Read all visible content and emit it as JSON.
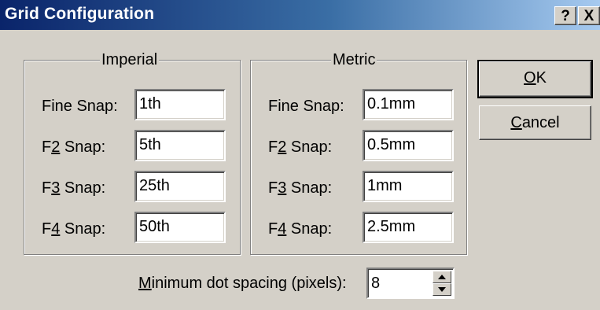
{
  "window": {
    "title": "Grid Configuration",
    "help_label": "?",
    "close_label": "X"
  },
  "imperial": {
    "title": "Imperial",
    "rows": [
      {
        "label_pre": "Fine Snap:",
        "label_u": "",
        "label_post": "",
        "value": "1th"
      },
      {
        "label_pre": "F",
        "label_u": "2",
        "label_post": " Snap:",
        "value": "5th"
      },
      {
        "label_pre": "F",
        "label_u": "3",
        "label_post": " Snap:",
        "value": "25th"
      },
      {
        "label_pre": "F",
        "label_u": "4",
        "label_post": " Snap:",
        "value": "50th"
      }
    ]
  },
  "metric": {
    "title": "Metric",
    "rows": [
      {
        "label_pre": "Fine Snap:",
        "label_u": "",
        "label_post": "",
        "value": "0.1mm"
      },
      {
        "label_pre": "F",
        "label_u": "2",
        "label_post": " Snap:",
        "value": "0.5mm"
      },
      {
        "label_pre": "F",
        "label_u": "3",
        "label_post": " Snap:",
        "value": "1mm"
      },
      {
        "label_pre": "F",
        "label_u": "4",
        "label_post": " Snap:",
        "value": "2.5mm"
      }
    ]
  },
  "buttons": {
    "ok_u": "O",
    "ok_rest": "K",
    "cancel_u": "C",
    "cancel_rest": "ancel"
  },
  "spacing": {
    "label_u": "M",
    "label_rest": "inimum dot spacing (pixels):",
    "value": "8"
  },
  "icons": {
    "help": "question-icon",
    "close": "close-icon",
    "spin_up": "triangle-up-icon",
    "spin_down": "triangle-down-icon"
  }
}
